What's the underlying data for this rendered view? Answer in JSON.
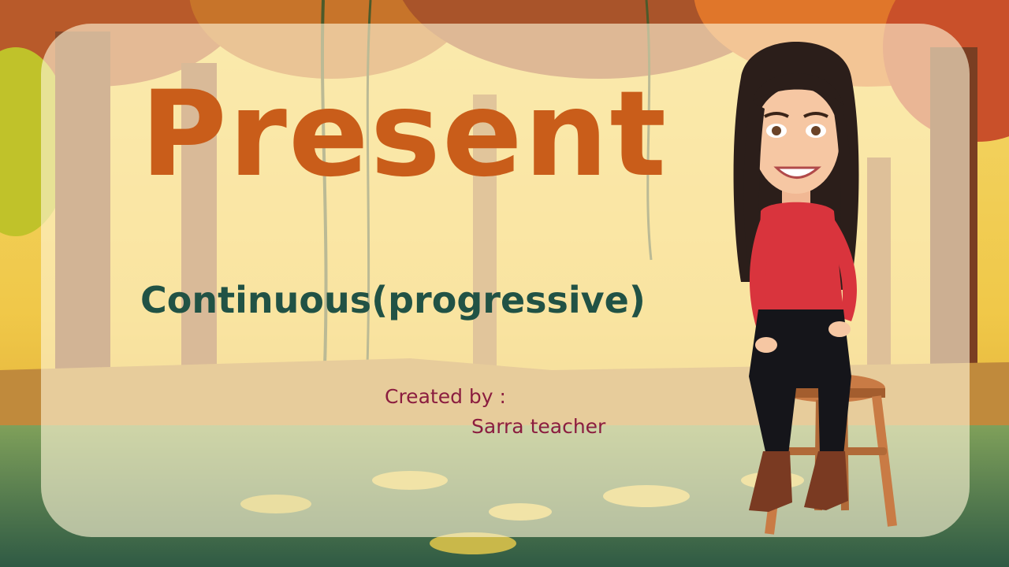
{
  "slide": {
    "title": "Present",
    "subtitle": "Continuous(progressive)",
    "credit_label": "Created by :",
    "credit_name": "Sarra teacher"
  },
  "colors": {
    "title": "#c95d1a",
    "subtitle": "#215245",
    "credit": "#8b1d3f",
    "panel": "#fff6d6"
  },
  "illustration": {
    "background": "autumn-forest-swamp",
    "character": "teacher-avatar-sitting-on-stool"
  }
}
